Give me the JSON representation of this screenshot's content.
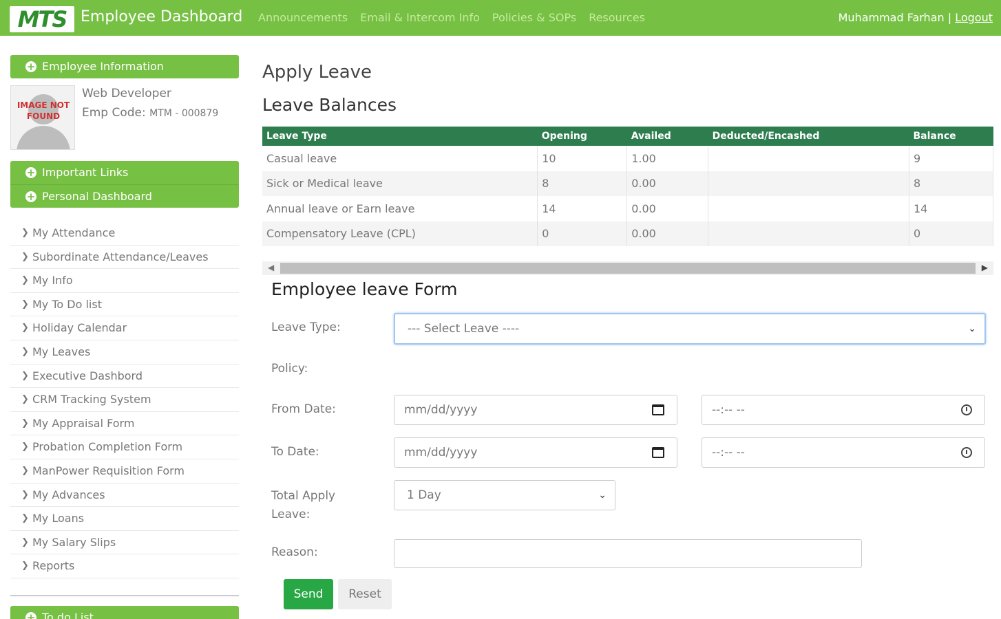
{
  "header": {
    "logo_text": "MTS",
    "title": "Employee Dashboard",
    "nav": [
      "Announcements",
      "Email & Intercom Info",
      "Policies & SOPs",
      "Resources"
    ],
    "user_name": "Muhammad Farhan",
    "separator": "|",
    "logout_label": "Logout",
    "brand_color": "#76c043"
  },
  "sidebar": {
    "employee_info_label": "Employee Information",
    "avatar_text": "IMAGE NOT FOUND",
    "role": "Web Developer",
    "emp_code_label": "Emp Code:",
    "emp_code_value": "MTM - 000879",
    "important_links_label": "Important Links",
    "personal_dashboard_label": "Personal Dashboard",
    "menu_items": [
      "My Attendance",
      "Subordinate Attendance/Leaves",
      "My Info",
      "My To Do list",
      "Holiday Calendar",
      "My Leaves",
      "Executive Dashbord",
      "CRM Tracking System",
      "My Appraisal Form",
      "Probation Completion Form",
      "ManPower Requisition Form",
      "My Advances",
      "My Loans",
      "My Salary Slips",
      "Reports"
    ],
    "todo_label": "To do List"
  },
  "main": {
    "page_title": "Apply Leave",
    "balances_title": "Leave Balances",
    "table": {
      "headers": [
        "Leave Type",
        "Opening",
        "Availed",
        "Deducted/Encashed",
        "Balance"
      ],
      "rows": [
        [
          "Casual leave",
          "10",
          "1.00",
          "",
          "9"
        ],
        [
          "Sick or Medical leave",
          "8",
          "0.00",
          "",
          "8"
        ],
        [
          "Annual leave or Earn leave",
          "14",
          "0.00",
          "",
          "14"
        ],
        [
          "Compensatory Leave (CPL)",
          "0",
          "0.00",
          "",
          "0"
        ]
      ]
    },
    "form": {
      "title": "Employee leave Form",
      "leave_type_label": "Leave Type:",
      "leave_type_value": "--- Select Leave ----",
      "policy_label": "Policy:",
      "from_date_label": "From Date:",
      "to_date_label": "To Date:",
      "date_placeholder": "mm/dd/yyyy",
      "time_placeholder": "--:-- --",
      "total_label_line1": "Total Apply",
      "total_label_line2": "Leave:",
      "total_value": "1 Day",
      "reason_label": "Reason:",
      "reason_value": "",
      "send_label": "Send",
      "reset_label": "Reset"
    }
  }
}
